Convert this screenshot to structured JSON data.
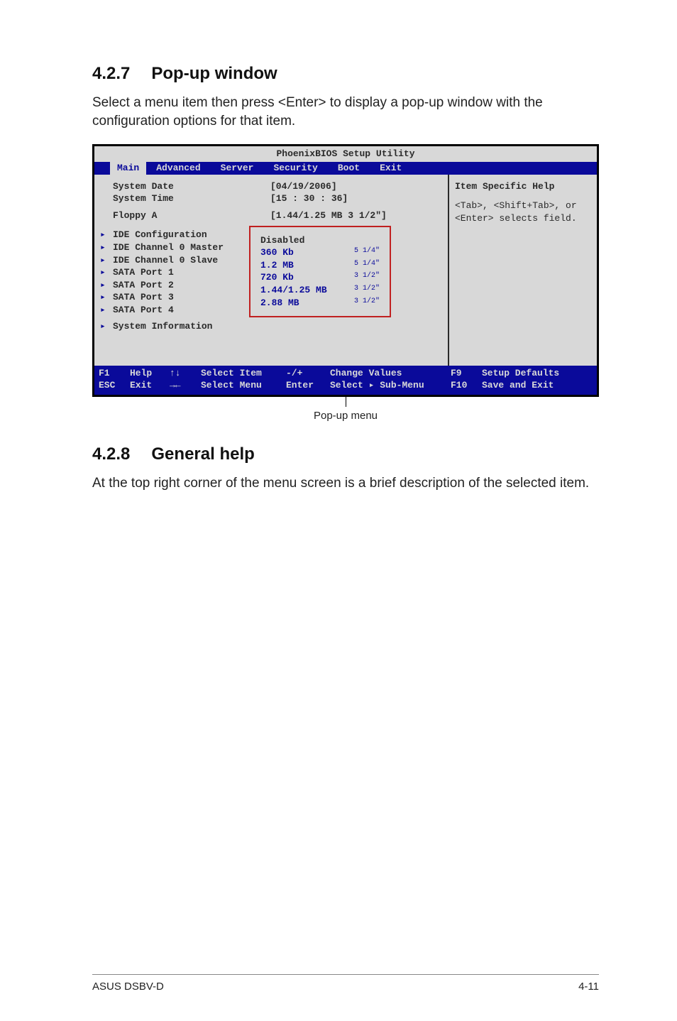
{
  "sections": {
    "popup": {
      "number": "4.2.7",
      "title": "Pop-up window",
      "body": "Select a menu item then press <Enter> to display a pop-up window with the configuration options for that item."
    },
    "general": {
      "number": "4.2.8",
      "title": "General help",
      "body": "At the top right corner of the menu screen is a brief description of the selected item."
    }
  },
  "bios": {
    "title": "PhoenixBIOS Setup Utility",
    "tabs": [
      "Main",
      "Advanced",
      "Server",
      "Security",
      "Boot",
      "Exit"
    ],
    "active_tab_index": 0,
    "rows": {
      "system_date": {
        "label": "System Date",
        "value": "[04/19/2006]"
      },
      "system_time": {
        "label": "System Time",
        "value": "[15 : 30 : 36]"
      },
      "floppy_a": {
        "label": "Floppy A",
        "value": "[1.44/1.25 MB    3 1/2\"]"
      }
    },
    "submenus": [
      "IDE Configuration",
      "IDE Channel 0 Master",
      "IDE Channel 0 Slave",
      "SATA Port 1",
      "SATA Port 2",
      "SATA Port 3",
      "SATA Port 4"
    ],
    "submenu_tail": "System Information",
    "help": {
      "title": "Item Specific Help",
      "text": "<Tab>, <Shift+Tab>, or <Enter> selects field."
    },
    "popup": {
      "options": [
        {
          "opt": "Disabled",
          "meta": ""
        },
        {
          "opt": "360 Kb",
          "meta": "5 1/4\""
        },
        {
          "opt": "1.2 MB",
          "meta": "5 1/4\""
        },
        {
          "opt": "720 Kb",
          "meta": "3 1/2\""
        },
        {
          "opt": "1.44/1.25 MB",
          "meta": "3 1/2\""
        },
        {
          "opt": "2.88 MB",
          "meta": "3 1/2\""
        }
      ]
    },
    "footer": {
      "r1": [
        "F1",
        "Help",
        "↑↓",
        "Select Item",
        "-/+",
        "Change Values",
        "F9",
        "Setup Defaults"
      ],
      "r2": [
        "ESC",
        "Exit",
        "→←",
        "Select Menu",
        "Enter",
        "Select ▸ Sub-Menu",
        "F10",
        "Save and Exit"
      ]
    }
  },
  "caption": "Pop-up menu",
  "pagefoot": {
    "left": "ASUS DSBV-D",
    "right": "4-11"
  }
}
